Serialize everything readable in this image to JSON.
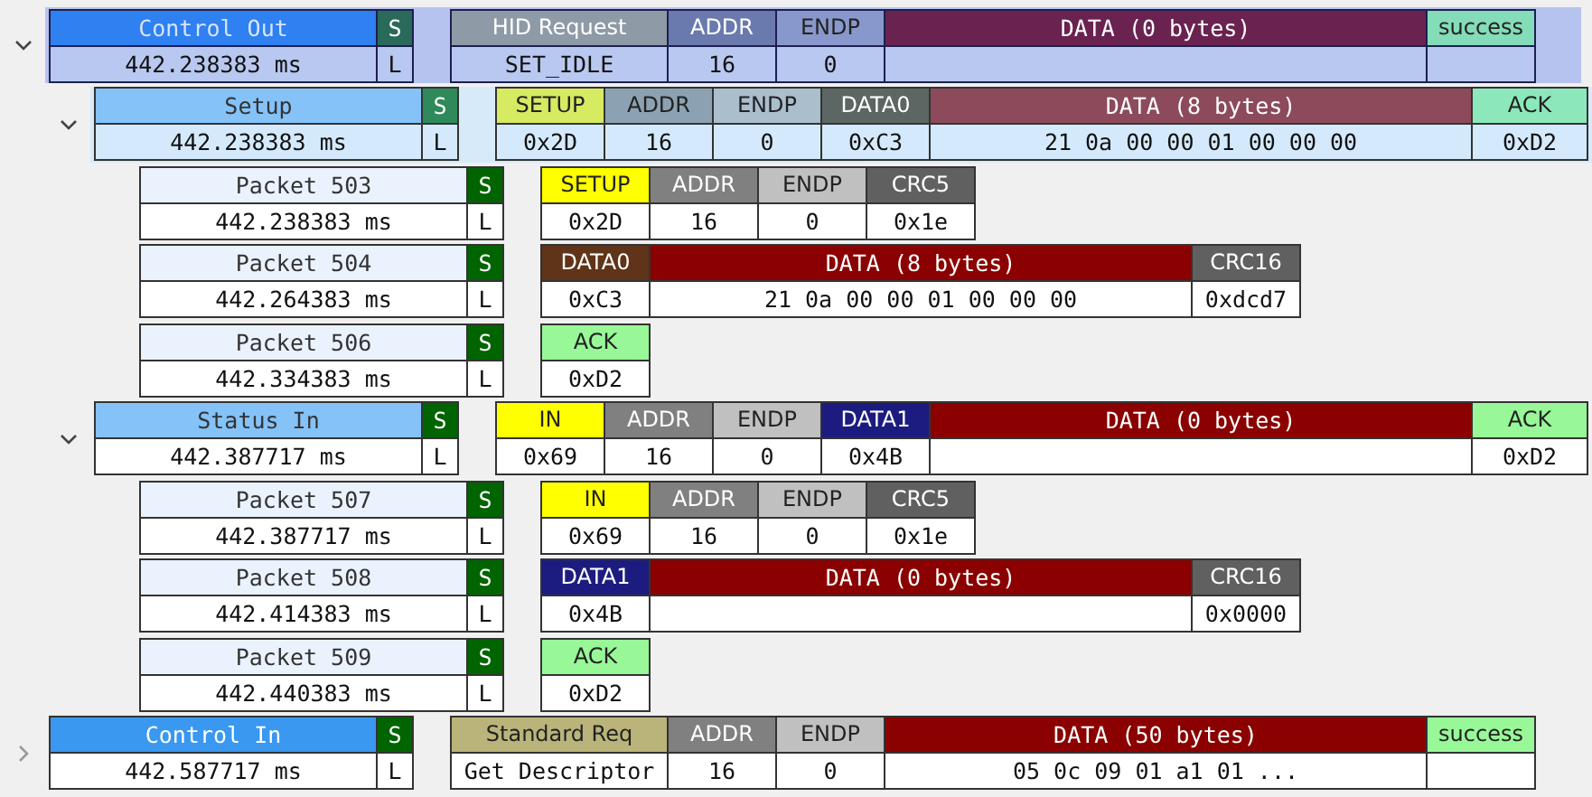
{
  "rows": [
    {
      "name": "Control Out",
      "time": "442.238383 ms",
      "flag_top": "S",
      "flag_bottom": "L",
      "color": "#2f80f0",
      "expanded": true,
      "selected": true,
      "highlighted": false,
      "fields": [
        {
          "kind": "label",
          "header": "HID Request",
          "value": "SET_IDLE",
          "color": "#8e9aa6"
        },
        {
          "kind": "pid",
          "header": "ADDR",
          "value": "16",
          "color": "#6a7aae"
        },
        {
          "kind": "pid",
          "header": "ENDP",
          "value": "0",
          "color": "#8898cc"
        },
        {
          "kind": "data",
          "header": "DATA (0 bytes)",
          "color": "#6a2250"
        },
        {
          "kind": "pid",
          "header": "success",
          "color": "#84dcb8"
        }
      ],
      "children": [
        {
          "name": "Setup",
          "time": "442.238383 ms",
          "flag_top": "S",
          "flag_bottom": "L",
          "color": "#84c2f8",
          "expanded": true,
          "selected": false,
          "highlighted": true,
          "fields": [
            {
              "kind": "pid",
              "header": "SETUP",
              "value": "0x2D",
              "color": "#d6ea62"
            },
            {
              "kind": "pid",
              "header": "ADDR",
              "value": "16",
              "color": "#8ca2b2"
            },
            {
              "kind": "pid",
              "header": "ENDP",
              "value": "0",
              "color": "#aabecc"
            },
            {
              "kind": "pid",
              "header": "DATA0",
              "value": "0xC3",
              "color": "#5c6662"
            },
            {
              "kind": "data",
              "header": "DATA (8 bytes)",
              "value": "21 0a 00 00 01 00 00 00",
              "color": "#8c4a5a"
            },
            {
              "kind": "ack",
              "header": "ACK",
              "value": "0xD2",
              "color": "#8ce8ba"
            }
          ],
          "children": [
            {
              "name": "Packet 503",
              "time": "442.238383 ms",
              "flag_top": "S",
              "flag_bottom": "L",
              "color": "#eaf2fe",
              "selected": false,
              "highlighted": false,
              "fields": [
                {
                  "kind": "pid",
                  "header": "SETUP",
                  "value": "0x2D",
                  "color": "#ffff00"
                },
                {
                  "kind": "pid",
                  "header": "ADDR",
                  "value": "16",
                  "color": "#808080"
                },
                {
                  "kind": "pid",
                  "header": "ENDP",
                  "value": "0",
                  "color": "#c0c0c0"
                },
                {
                  "kind": "pid",
                  "header": "CRC5",
                  "value": "0x1e",
                  "color": "#606060"
                }
              ]
            },
            {
              "name": "Packet 504",
              "time": "442.264383 ms",
              "flag_top": "S",
              "flag_bottom": "L",
              "color": "#eaf2fe",
              "selected": false,
              "highlighted": false,
              "fields": [
                {
                  "kind": "pid",
                  "header": "DATA0",
                  "value": "0xC3",
                  "color": "#603418"
                },
                {
                  "kind": "data",
                  "header": "DATA (8 bytes)",
                  "value": "21 0a 00 00 01 00 00 00",
                  "color": "#8b0000"
                },
                {
                  "kind": "pid",
                  "header": "CRC16",
                  "value": "0xdcd7",
                  "color": "#606060"
                }
              ]
            },
            {
              "name": "Packet 506",
              "time": "442.334383 ms",
              "flag_top": "S",
              "flag_bottom": "L",
              "color": "#eaf2fe",
              "selected": false,
              "highlighted": false,
              "fields": [
                {
                  "kind": "pid",
                  "header": "ACK",
                  "value": "0xD2",
                  "color": "#98f898"
                }
              ]
            }
          ]
        },
        {
          "name": "Status In",
          "time": "442.387717 ms",
          "flag_top": "S",
          "flag_bottom": "L",
          "color": "#84c2f8",
          "expanded": true,
          "selected": false,
          "highlighted": false,
          "fields": [
            {
              "kind": "pid",
              "header": "IN",
              "value": "0x69",
              "color": "#ffff00"
            },
            {
              "kind": "pid",
              "header": "ADDR",
              "value": "16",
              "color": "#808080"
            },
            {
              "kind": "pid",
              "header": "ENDP",
              "value": "0",
              "color": "#c0c0c0"
            },
            {
              "kind": "pid",
              "header": "DATA1",
              "value": "0x4B",
              "color": "#1c1c80"
            },
            {
              "kind": "data",
              "header": "DATA (0 bytes)",
              "color": "#8b0000"
            },
            {
              "kind": "ack",
              "header": "ACK",
              "value": "0xD2",
              "color": "#98f898"
            }
          ],
          "children": [
            {
              "name": "Packet 507",
              "time": "442.387717 ms",
              "flag_top": "S",
              "flag_bottom": "L",
              "color": "#eaf2fe",
              "selected": false,
              "highlighted": false,
              "fields": [
                {
                  "kind": "pid",
                  "header": "IN",
                  "value": "0x69",
                  "color": "#ffff00"
                },
                {
                  "kind": "pid",
                  "header": "ADDR",
                  "value": "16",
                  "color": "#808080"
                },
                {
                  "kind": "pid",
                  "header": "ENDP",
                  "value": "0",
                  "color": "#c0c0c0"
                },
                {
                  "kind": "pid",
                  "header": "CRC5",
                  "value": "0x1e",
                  "color": "#606060"
                }
              ]
            },
            {
              "name": "Packet 508",
              "time": "442.414383 ms",
              "flag_top": "S",
              "flag_bottom": "L",
              "color": "#eaf2fe",
              "selected": false,
              "highlighted": false,
              "fields": [
                {
                  "kind": "pid",
                  "header": "DATA1",
                  "value": "0x4B",
                  "color": "#1c1c80"
                },
                {
                  "kind": "data",
                  "header": "DATA (0 bytes)",
                  "color": "#8b0000"
                },
                {
                  "kind": "pid",
                  "header": "CRC16",
                  "value": "0x0000",
                  "color": "#606060"
                }
              ]
            },
            {
              "name": "Packet 509",
              "time": "442.440383 ms",
              "flag_top": "S",
              "flag_bottom": "L",
              "color": "#eaf2fe",
              "selected": false,
              "highlighted": false,
              "fields": [
                {
                  "kind": "pid",
                  "header": "ACK",
                  "value": "0xD2",
                  "color": "#98f898"
                }
              ]
            }
          ]
        }
      ]
    },
    {
      "name": "Control In",
      "time": "442.587717 ms",
      "flag_top": "S",
      "flag_bottom": "L",
      "color": "#3a98f0",
      "expanded": false,
      "selected": false,
      "highlighted": false,
      "fields": [
        {
          "kind": "label",
          "header": "Standard Req",
          "value": "Get Descriptor",
          "color": "#bab47a"
        },
        {
          "kind": "pid",
          "header": "ADDR",
          "value": "16",
          "color": "#808080"
        },
        {
          "kind": "pid",
          "header": "ENDP",
          "value": "0",
          "color": "#c0c0c0"
        },
        {
          "kind": "data",
          "header": "DATA (50 bytes)",
          "value": "05 0c 09 01 a1 01 ...",
          "color": "#8b0000"
        },
        {
          "kind": "pid",
          "header": "success",
          "color": "#98f898"
        }
      ]
    }
  ]
}
